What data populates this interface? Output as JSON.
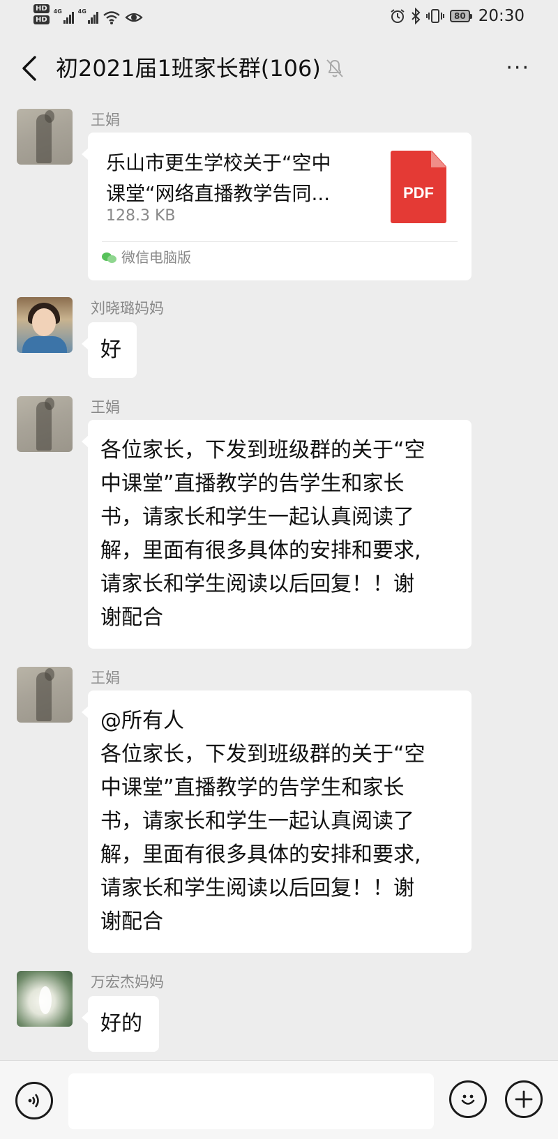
{
  "status_bar": {
    "sim1": "HD",
    "sim2": "HD",
    "network1": "4G",
    "network2": "4G",
    "battery": "80",
    "time": "20:30"
  },
  "header": {
    "title": "初2021届1班家长群(106)",
    "back_icon": "chevron-left-icon",
    "muted_icon": "bell-muted-icon",
    "more_label": "···"
  },
  "messages": [
    {
      "sender": "王娟",
      "type": "file",
      "file_name_line1": "乐山市更生学校关于“空中",
      "file_name_line2": "课堂“网络直播教学告同...",
      "file_size": "128.3 KB",
      "file_badge": "PDF",
      "source": "微信电脑版"
    },
    {
      "sender": "刘晓璐妈妈",
      "type": "text",
      "lines": [
        "好"
      ]
    },
    {
      "sender": "王娟",
      "type": "text",
      "lines": [
        "各位家长，下发到班级群的关于“空",
        "中课堂”直播教学的告学生和家长",
        "书，请家长和学生一起认真阅读了",
        "解，里面有很多具体的安排和要求,",
        "请家长和学生阅读以后回复！！谢",
        "谢配合"
      ]
    },
    {
      "sender": "王娟",
      "type": "text",
      "lines": [
        "@所有人",
        "各位家长，下发到班级群的关于“空",
        "中课堂”直播教学的告学生和家长",
        "书，请家长和学生一起认真阅读了",
        "解，里面有很多具体的安排和要求,",
        "请家长和学生阅读以后回复！！谢",
        "谢配合"
      ]
    },
    {
      "sender": "万宏杰妈妈",
      "type": "text",
      "lines": [
        "好的"
      ]
    }
  ],
  "input_bar": {
    "voice_icon": "voice-icon",
    "emoji_icon": "emoji-icon",
    "plus_icon": "plus-icon",
    "text_value": ""
  }
}
